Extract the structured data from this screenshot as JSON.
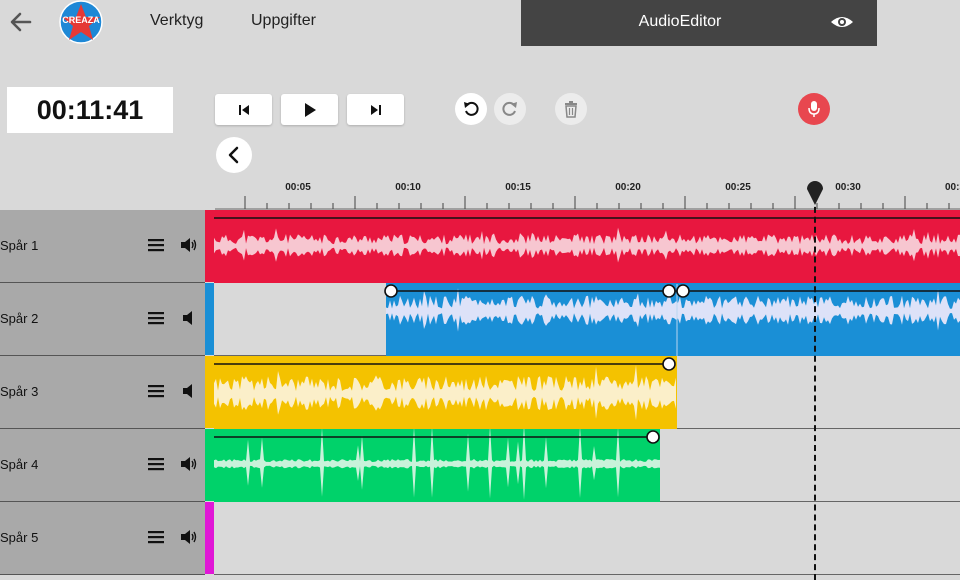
{
  "nav": {
    "menu1": "Verktyg",
    "menu2": "Uppgifter",
    "logo_text": "CREAZA"
  },
  "app": {
    "title": "AudioEditor"
  },
  "transport": {
    "time": "00:11:41"
  },
  "timeline": {
    "ticks": [
      "00:05",
      "00:10",
      "00:15",
      "00:20",
      "00:25",
      "00:30",
      "00:3"
    ]
  },
  "tracks": [
    {
      "label": "Spår 1",
      "color": "#e8173f"
    },
    {
      "label": "Spår 2",
      "color": "#1a8fd6"
    },
    {
      "label": "Spår 3",
      "color": "#f4c200"
    },
    {
      "label": "Spår 4",
      "color": "#00d26a"
    },
    {
      "label": "Spår 5",
      "color": "#e017d6"
    }
  ],
  "icons": [
    "back-arrow-icon",
    "creaza-logo",
    "eye-icon",
    "skip-back-icon",
    "play-icon",
    "skip-forward-icon",
    "collapse-icon",
    "undo-icon",
    "redo-icon",
    "trash-icon",
    "microphone-icon",
    "hamburger-icon",
    "speaker-icon",
    "playhead-marker-icon"
  ]
}
